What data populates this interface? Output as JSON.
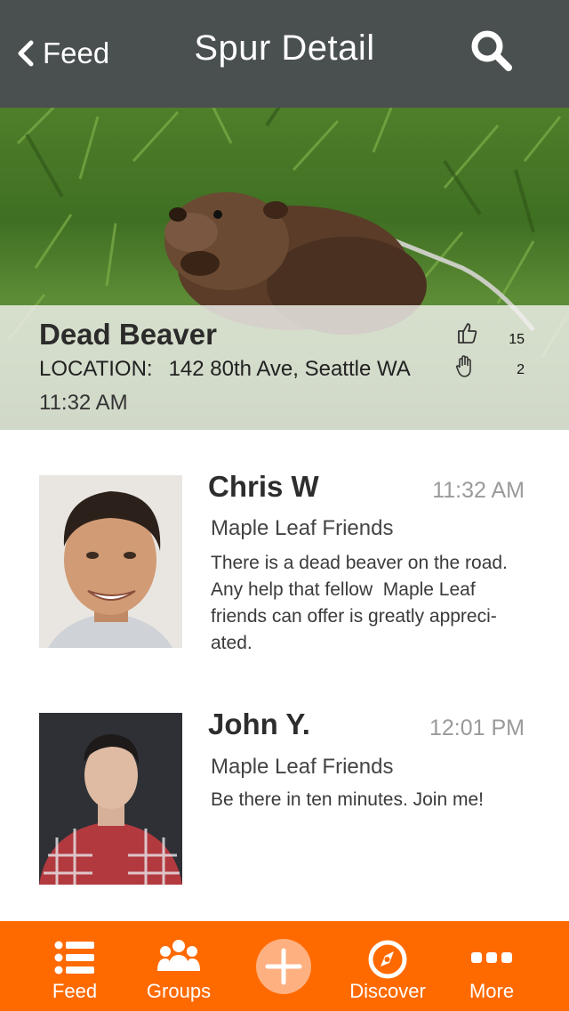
{
  "header": {
    "back_label": "Feed",
    "title": "Spur Detail"
  },
  "spur": {
    "name": "Dead Beaver",
    "location_label": "LOCATION:",
    "location_value": "142 80th Ave, Seattle WA",
    "time": "11:32 AM",
    "likes": "15",
    "hands": "2"
  },
  "comments": [
    {
      "name": "Chris W",
      "time": "11:32 AM",
      "group": "Maple Leaf Friends",
      "text_lines": [
        "There is a dead beaver on the road.",
        "Any help that fellow  Maple Leaf",
        "friends can offer is greatly appreci-",
        "ated."
      ]
    },
    {
      "name": "John Y.",
      "time": "12:01 PM",
      "group": "Maple Leaf Friends",
      "text_lines": [
        "Be there in ten minutes. Join me!"
      ]
    }
  ],
  "tabs": [
    {
      "label": "Feed",
      "icon": "list-icon"
    },
    {
      "label": "Groups",
      "icon": "group-icon"
    },
    {
      "label": "",
      "icon": "plus-icon"
    },
    {
      "label": "Discover",
      "icon": "compass-icon"
    },
    {
      "label": "More",
      "icon": "more-icon"
    }
  ],
  "colors": {
    "topbar": "#4a4f50",
    "accent": "#ff6a00"
  }
}
